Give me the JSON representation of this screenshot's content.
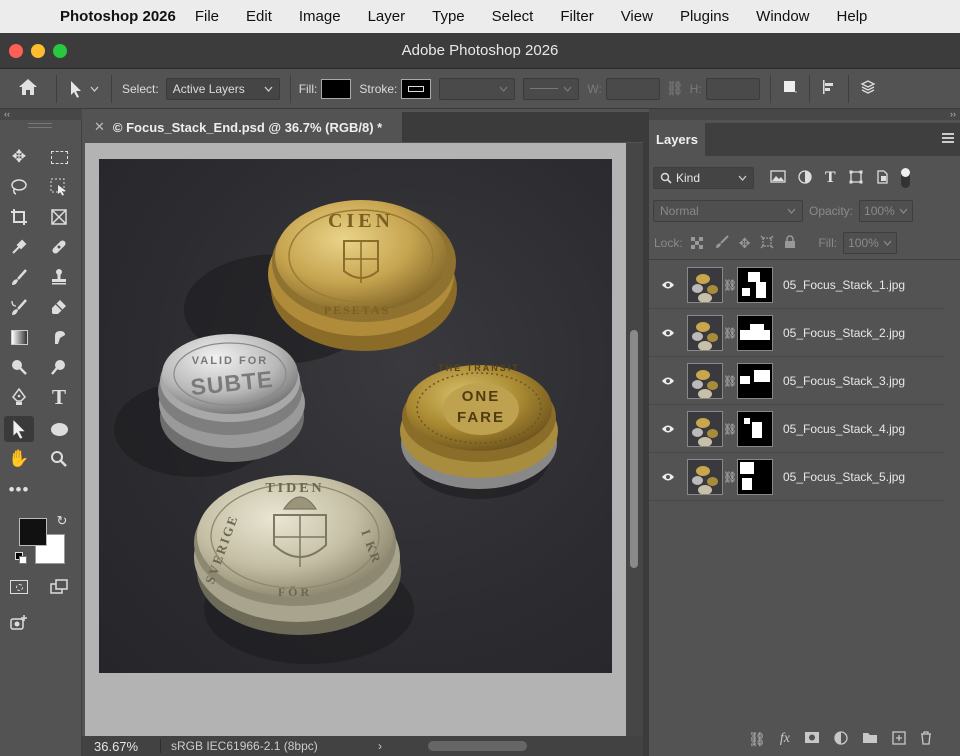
{
  "menubar": {
    "app_name": "Photoshop 2026",
    "items": [
      "File",
      "Edit",
      "Image",
      "Layer",
      "Type",
      "Select",
      "Filter",
      "View",
      "Plugins",
      "Window",
      "Help"
    ]
  },
  "window": {
    "title": "Adobe Photoshop 2026"
  },
  "options_bar": {
    "select_label": "Select:",
    "select_value": "Active Layers",
    "fill_label": "Fill:",
    "stroke_label": "Stroke:",
    "w_label": "W:",
    "h_label": "H:",
    "fill_color": "#000000"
  },
  "document": {
    "tab_title": "© Focus_Stack_End.psd @ 36.7% (RGB/8) *"
  },
  "status": {
    "zoom": "36.67%",
    "profile": "sRGB IEC61966-2.1 (8bpc)"
  },
  "layers_panel": {
    "tab_label": "Layers",
    "filter_kind": "Kind",
    "blend_mode": "Normal",
    "opacity_label": "Opacity:",
    "opacity_value": "100%",
    "lock_label": "Lock:",
    "fill_label": "Fill:",
    "fill_value": "100%",
    "layers": [
      {
        "name": "05_Focus_Stack_1.jpg"
      },
      {
        "name": "05_Focus_Stack_2.jpg"
      },
      {
        "name": "05_Focus_Stack_3.jpg"
      },
      {
        "name": "05_Focus_Stack_4.jpg"
      },
      {
        "name": "05_Focus_Stack_5.jpg"
      }
    ]
  },
  "photo": {
    "coin_top": {
      "text_top": "CIEN",
      "text_bottom": "PESETAS"
    },
    "coin_left": {
      "text_top": "VALID FOR",
      "text_main": "SUBTE"
    },
    "coin_right": {
      "text_main_1": "ONE",
      "text_main_2": "FARE",
      "text_ring": "THE TRANSIT"
    },
    "coin_bottom": {
      "text_top": "TIDEN",
      "text_left": "SVERIGE",
      "text_right": "I KR",
      "text_bottom": "FÖR"
    }
  },
  "colors": {
    "foreground": "#111111",
    "background": "#ffffff",
    "ps_bg": "#535353"
  }
}
